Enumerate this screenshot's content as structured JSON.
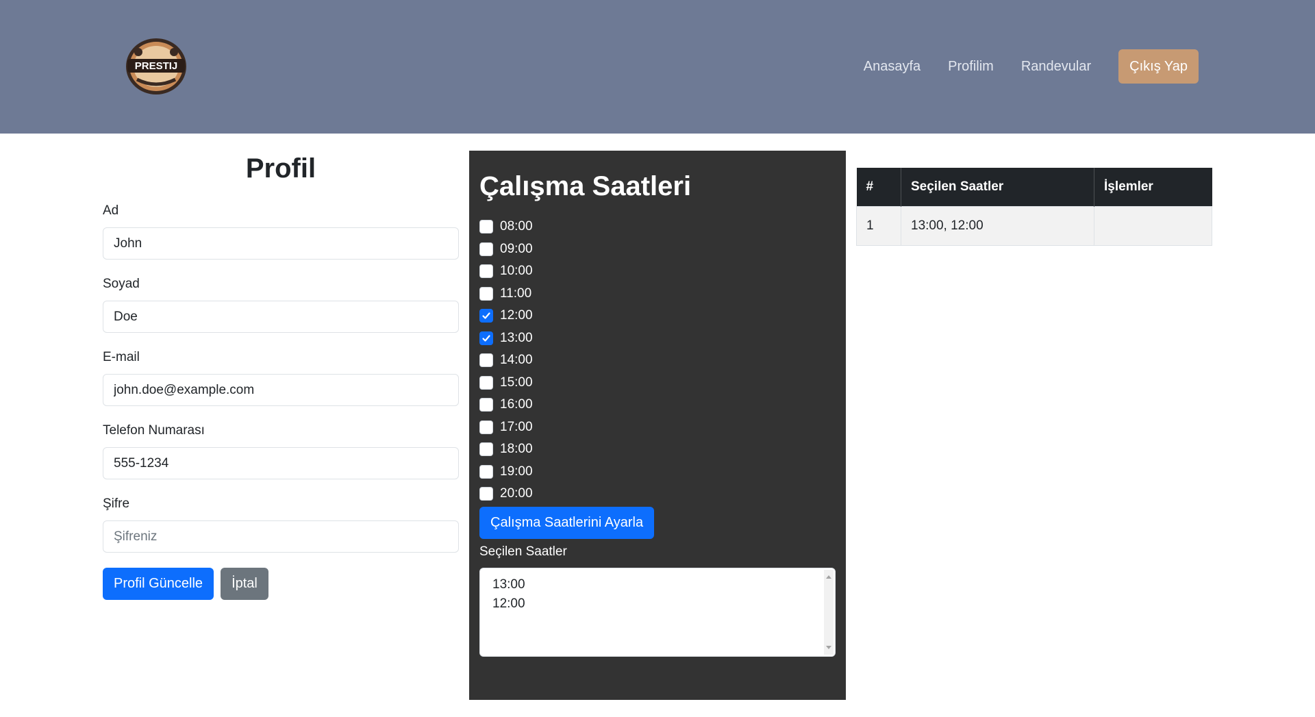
{
  "header": {
    "logo_text": "PRESTIJ",
    "nav": [
      "Anasayfa",
      "Profilim",
      "Randevular"
    ],
    "logout_label": "Çıkış Yap"
  },
  "profile": {
    "title": "Profil",
    "fields": [
      {
        "label": "Ad",
        "value": "John",
        "placeholder": ""
      },
      {
        "label": "Soyad",
        "value": "Doe",
        "placeholder": ""
      },
      {
        "label": "E-mail",
        "value": "john.doe@example.com",
        "placeholder": ""
      },
      {
        "label": "Telefon Numarası",
        "value": "555-1234",
        "placeholder": ""
      },
      {
        "label": "Şifre",
        "value": "",
        "placeholder": "Şifreniz"
      }
    ],
    "update_label": "Profil Güncelle",
    "cancel_label": "İptal"
  },
  "hours": {
    "title": "Çalışma Saatleri",
    "options": [
      {
        "time": "08:00",
        "checked": false
      },
      {
        "time": "09:00",
        "checked": false
      },
      {
        "time": "10:00",
        "checked": false
      },
      {
        "time": "11:00",
        "checked": false
      },
      {
        "time": "12:00",
        "checked": true
      },
      {
        "time": "13:00",
        "checked": true
      },
      {
        "time": "14:00",
        "checked": false
      },
      {
        "time": "15:00",
        "checked": false
      },
      {
        "time": "16:00",
        "checked": false
      },
      {
        "time": "17:00",
        "checked": false
      },
      {
        "time": "18:00",
        "checked": false
      },
      {
        "time": "19:00",
        "checked": false
      },
      {
        "time": "20:00",
        "checked": false
      }
    ],
    "set_button_label": "Çalışma Saatlerini Ayarla",
    "selected_label": "Seçilen Saatler",
    "selected_list": [
      "13:00",
      "12:00"
    ]
  },
  "table": {
    "headers": [
      "#",
      "Seçilen Saatler",
      "İşlemler"
    ],
    "rows": [
      [
        "1",
        "13:00, 12:00",
        ""
      ]
    ]
  }
}
